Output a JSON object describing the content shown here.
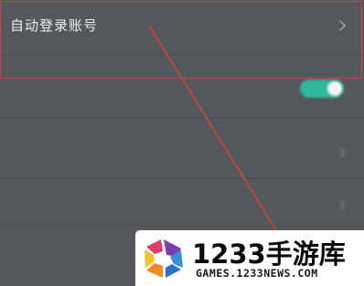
{
  "settings": {
    "rows": [
      {
        "label": "自动登录账号",
        "has_chevron": true
      },
      {
        "label": "",
        "toggle": {
          "on": true,
          "color": "#2fb99a"
        }
      },
      {
        "label": "",
        "value": "",
        "has_chevron": true
      },
      {
        "label": "",
        "has_chevron": true
      },
      {
        "label": ""
      }
    ]
  },
  "annotation": {
    "color": "#d9443a"
  },
  "watermark": {
    "brand": "1233手游库",
    "site": "GAMES.1233NEWS.COM"
  }
}
